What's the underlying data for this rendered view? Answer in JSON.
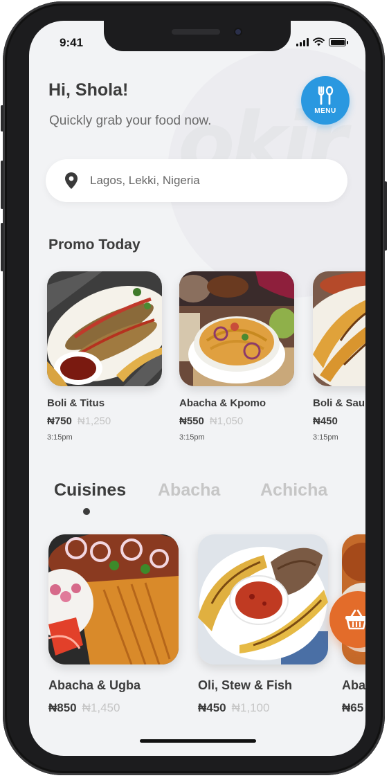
{
  "status": {
    "time": "9:41"
  },
  "header": {
    "greeting": "Hi, Shola!",
    "subtitle": "Quickly grab your food now.",
    "menu_label": "MENU",
    "watermark": "okir"
  },
  "search": {
    "location": "Lagos, Lekki, Nigeria",
    "icon": "location-pin-icon"
  },
  "promo": {
    "title": "Promo Today",
    "items": [
      {
        "name": "Boli & Titus",
        "price": "₦750",
        "old_price": "₦1,250",
        "time": "3:15pm"
      },
      {
        "name": "Abacha & Kpomo",
        "price": "₦550",
        "old_price": "₦1,050",
        "time": "3:15pm"
      },
      {
        "name": "Boli & Sau",
        "price": "₦450",
        "old_price": "",
        "time": "3:15pm"
      }
    ]
  },
  "tabs": [
    {
      "label": "Cuisines",
      "active": true
    },
    {
      "label": "Abacha",
      "active": false
    },
    {
      "label": "Achicha",
      "active": false
    }
  ],
  "cuisines": {
    "items": [
      {
        "name": "Abacha & Ugba",
        "price": "₦850",
        "old_price": "₦1,450"
      },
      {
        "name": "Oli, Stew & Fish",
        "price": "₦450",
        "old_price": "₦1,100"
      },
      {
        "name": "Aba",
        "price": "₦65",
        "old_price": ""
      }
    ]
  },
  "colors": {
    "accent_blue": "#2a98e0",
    "basket_orange": "#e36c2a",
    "background": "#f2f3f5",
    "text_dark": "#3c3c3c",
    "text_muted": "#c5c5c5"
  },
  "icons": [
    "menu-fork-spoon-icon",
    "location-pin-icon",
    "basket-icon"
  ]
}
